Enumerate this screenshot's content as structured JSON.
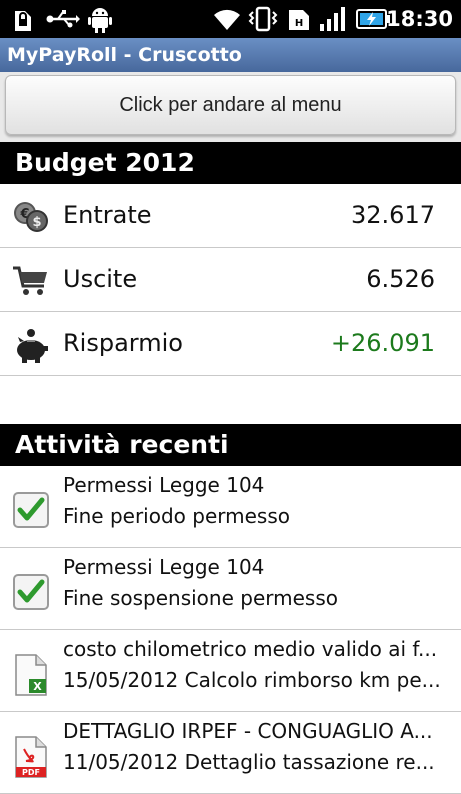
{
  "status_bar": {
    "icons": [
      "sim-lock-icon",
      "usb-icon",
      "android-debug-icon",
      "wifi-icon",
      "vibrate-icon",
      "data-icon",
      "signal-icon",
      "battery-charging-icon"
    ],
    "time": "18:30"
  },
  "app": {
    "title": "MyPayRoll - Cruscotto"
  },
  "menu_button": {
    "label": "Click per andare al menu"
  },
  "budget": {
    "header": "Budget 2012",
    "rows": [
      {
        "label": "Entrate",
        "value": "32.617",
        "icon": "coins-icon"
      },
      {
        "label": "Uscite",
        "value": "6.526",
        "icon": "cart-icon"
      },
      {
        "label": "Risparmio",
        "value": "+26.091",
        "icon": "piggy-bank-icon"
      }
    ]
  },
  "activities": {
    "header": "Attività recenti",
    "items": [
      {
        "title": "Permessi Legge 104",
        "subtitle": "Fine periodo permesso",
        "icon": "checkbox-checked-icon"
      },
      {
        "title": "Permessi Legge 104",
        "subtitle": "Fine sospensione permesso",
        "icon": "checkbox-checked-icon"
      },
      {
        "title": "costo chilometrico medio valido ai f...",
        "subtitle": "15/05/2012 Calcolo rimborso km pe...",
        "icon": "excel-file-icon"
      },
      {
        "title": "DETTAGLIO IRPEF - CONGUAGLIO A...",
        "subtitle": "11/05/2012 Dettaglio tassazione re...",
        "icon": "pdf-file-icon"
      }
    ]
  },
  "colors": {
    "title_bar": "#5479b0",
    "positive_value": "#1c7a1c",
    "section_header": "#000000"
  }
}
